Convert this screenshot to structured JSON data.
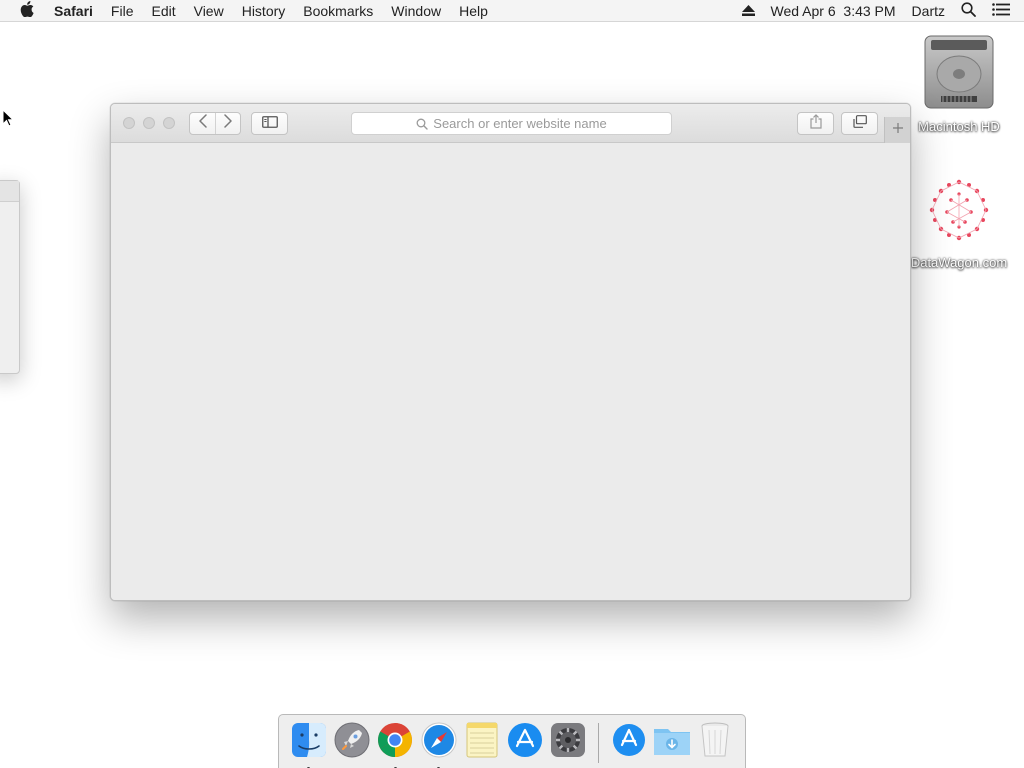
{
  "menubar": {
    "app_name": "Safari",
    "items": [
      "File",
      "Edit",
      "View",
      "History",
      "Bookmarks",
      "Window",
      "Help"
    ],
    "clock": "Wed Apr 6  3:43 PM",
    "user": "Dartz",
    "icons": [
      "apple-icon",
      "eject-icon",
      "spotlight-search-icon",
      "notification-center-icon"
    ]
  },
  "desktop": {
    "icons": [
      {
        "label": "Macintosh HD",
        "icon": "hard-drive-icon"
      },
      {
        "label": "DataWagon.com",
        "icon": "datawagon-icon"
      }
    ]
  },
  "safari": {
    "address_placeholder": "Search or enter website name",
    "toolbar_icons": [
      "back-icon",
      "forward-icon",
      "sidebar-icon",
      "share-icon",
      "tabs-overview-icon",
      "new-tab-icon"
    ],
    "colors": {
      "content_bg": "#ebebeb",
      "toolbar_bg": "#dcdcdc"
    }
  },
  "dock": {
    "apps": [
      {
        "name": "Finder",
        "icon": "finder-icon",
        "running": true
      },
      {
        "name": "Launchpad",
        "icon": "launchpad-icon",
        "running": false
      },
      {
        "name": "Google Chrome",
        "icon": "chrome-icon",
        "running": true
      },
      {
        "name": "Safari",
        "icon": "safari-icon",
        "running": true
      },
      {
        "name": "Notes",
        "icon": "notes-icon",
        "running": false
      },
      {
        "name": "App Store",
        "icon": "app-store-icon",
        "running": false
      },
      {
        "name": "System Preferences",
        "icon": "system-preferences-icon",
        "running": false
      }
    ],
    "stacks": [
      {
        "name": "Applications",
        "icon": "applications-stack-icon"
      },
      {
        "name": "Downloads",
        "icon": "downloads-folder-icon"
      },
      {
        "name": "Trash",
        "icon": "trash-icon"
      }
    ]
  }
}
